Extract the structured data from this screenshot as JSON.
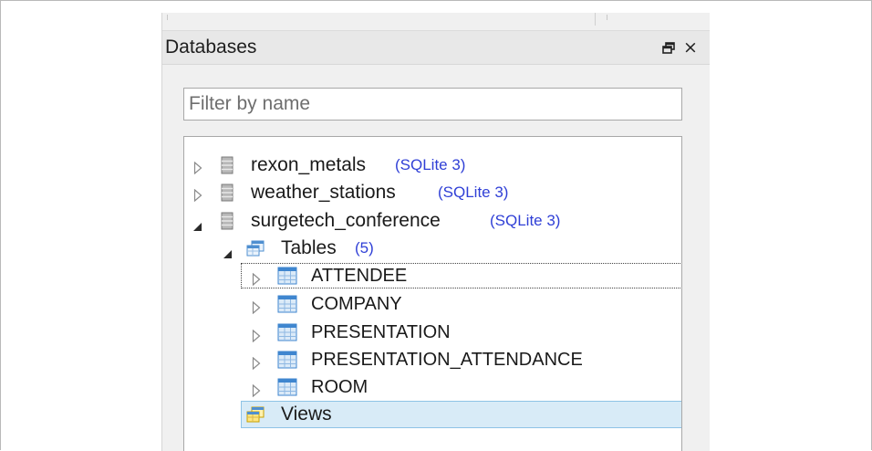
{
  "panel": {
    "title": "Databases",
    "float_icon": "float-window-icon",
    "close_icon": "close-icon",
    "close_glyph": "×"
  },
  "filter": {
    "placeholder": "Filter by name",
    "value": ""
  },
  "tree": {
    "databases": [
      {
        "name": "rexon_metals",
        "type": "(SQLite 3)",
        "expanded": false
      },
      {
        "name": "weather_stations",
        "type": "(SQLite 3)",
        "expanded": false
      },
      {
        "name": "surgetech_conference",
        "type": "(SQLite 3)",
        "expanded": true
      }
    ],
    "tables_folder": {
      "label": "Tables",
      "count": "(5)"
    },
    "tables": [
      "ATTENDEE",
      "COMPANY",
      "PRESENTATION",
      "PRESENTATION_ATTENDANCE",
      "ROOM"
    ],
    "views_folder": {
      "label": "Views"
    }
  },
  "colors": {
    "type_tag": "#2f3fd6",
    "selection_bg": "#d8ebf7",
    "selection_border": "#8ec3e6"
  }
}
